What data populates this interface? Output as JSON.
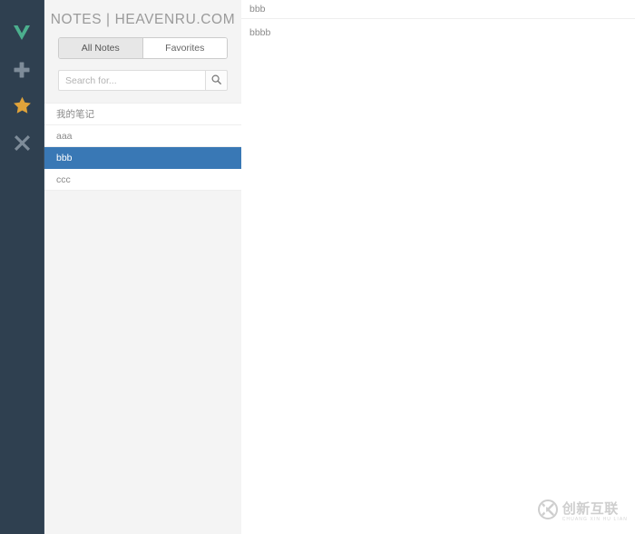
{
  "colors": {
    "rail_bg": "#2f4050",
    "accent_blue": "#3978b5",
    "panel_bg": "#f4f4f4",
    "icon_green": "#4caf8e",
    "icon_gray": "#7e8c99",
    "icon_orange": "#e0a33a",
    "text_gray": "#8a8a8a",
    "title_gray": "#9a9a9a"
  },
  "rail": {
    "items": [
      {
        "name": "v-check-icon",
        "label": "V"
      },
      {
        "name": "plus-icon",
        "label": "Add"
      },
      {
        "name": "star-icon",
        "label": "Favorite"
      },
      {
        "name": "close-x-icon",
        "label": "Delete"
      }
    ]
  },
  "list_panel": {
    "title": "NOTES | HEAVENRU.COM",
    "tabs": [
      {
        "label": "All Notes",
        "active": true
      },
      {
        "label": "Favorites",
        "active": false
      }
    ],
    "search": {
      "placeholder": "Search for...",
      "value": "",
      "button_icon": "search-icon"
    },
    "notes": [
      {
        "title": "我的笔记",
        "selected": false
      },
      {
        "title": "aaa",
        "selected": false
      },
      {
        "title": "bbb",
        "selected": true
      },
      {
        "title": "ccc",
        "selected": false
      }
    ]
  },
  "editor": {
    "title": "bbb",
    "body": "bbbb"
  },
  "watermark": {
    "mark": "CX",
    "cn": "创新互联",
    "en": "CHUANG XIN HU LIAN"
  }
}
